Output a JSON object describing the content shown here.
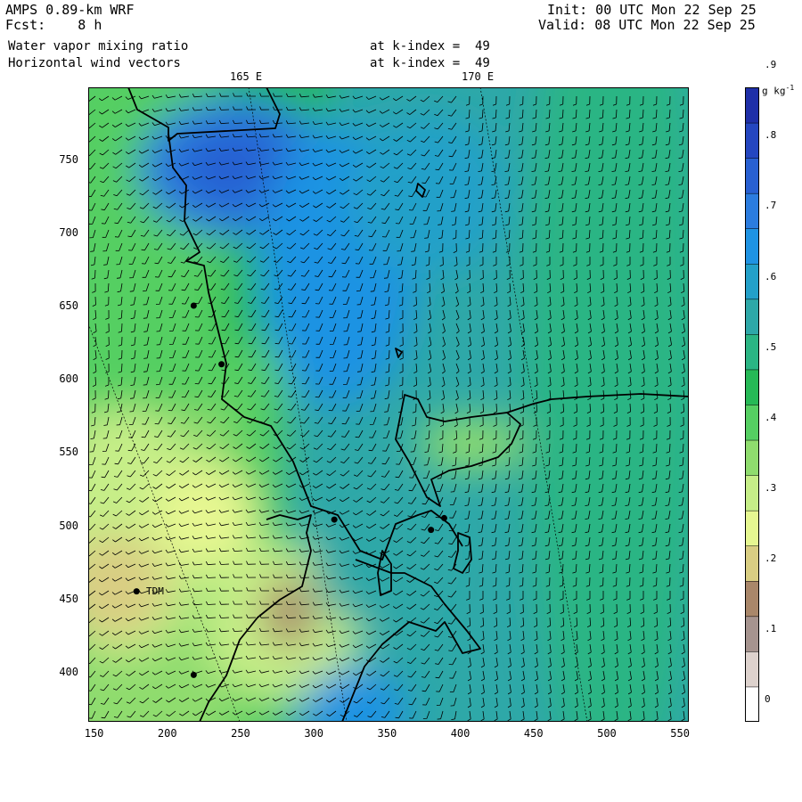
{
  "header": {
    "model": "AMPS 0.89-km WRF",
    "fcst_label": "Fcst:",
    "fcst_value": "8 h",
    "init": "Init: 00 UTC Mon 22 Sep 25",
    "valid": "Valid: 08 UTC Mon 22 Sep 25",
    "field1": "Water vapor mixing ratio",
    "field1_level": "at k-index =  49",
    "field2": "Horizontal wind vectors",
    "field2_level": "at k-index =  49"
  },
  "map": {
    "lon_labels": [
      "165 E",
      "170 E"
    ],
    "x_ticks": [
      150,
      200,
      250,
      300,
      350,
      400,
      450,
      500,
      550
    ],
    "y_ticks": [
      400,
      450,
      500,
      550,
      600,
      650,
      700,
      750
    ],
    "x_range": [
      146,
      556
    ],
    "y_range": [
      366,
      799
    ],
    "station_label": "TDM",
    "stations": [
      [
        218,
        650
      ],
      [
        237,
        610
      ],
      [
        314,
        504
      ],
      [
        380,
        497
      ],
      [
        389,
        505
      ],
      [
        179,
        455
      ],
      [
        218,
        398
      ]
    ]
  },
  "colorbar": {
    "unit": "g kg",
    "unit_exp": "-1",
    "labels": [
      "0",
      ".1",
      ".2",
      ".3",
      ".4",
      ".5",
      ".6",
      ".7",
      ".8",
      ".9"
    ],
    "colors": [
      "#ffffff",
      "#ddd2cd",
      "#a6948f",
      "#a9876a",
      "#d9ce83",
      "#e6f791",
      "#c6ee88",
      "#8fdc6e",
      "#55cf62",
      "#26b956",
      "#2bb584",
      "#2ea8a8",
      "#23a0c9",
      "#1f93e3",
      "#2b7cdf",
      "#2860d2",
      "#2446c0",
      "#1f2fa8"
    ]
  }
}
